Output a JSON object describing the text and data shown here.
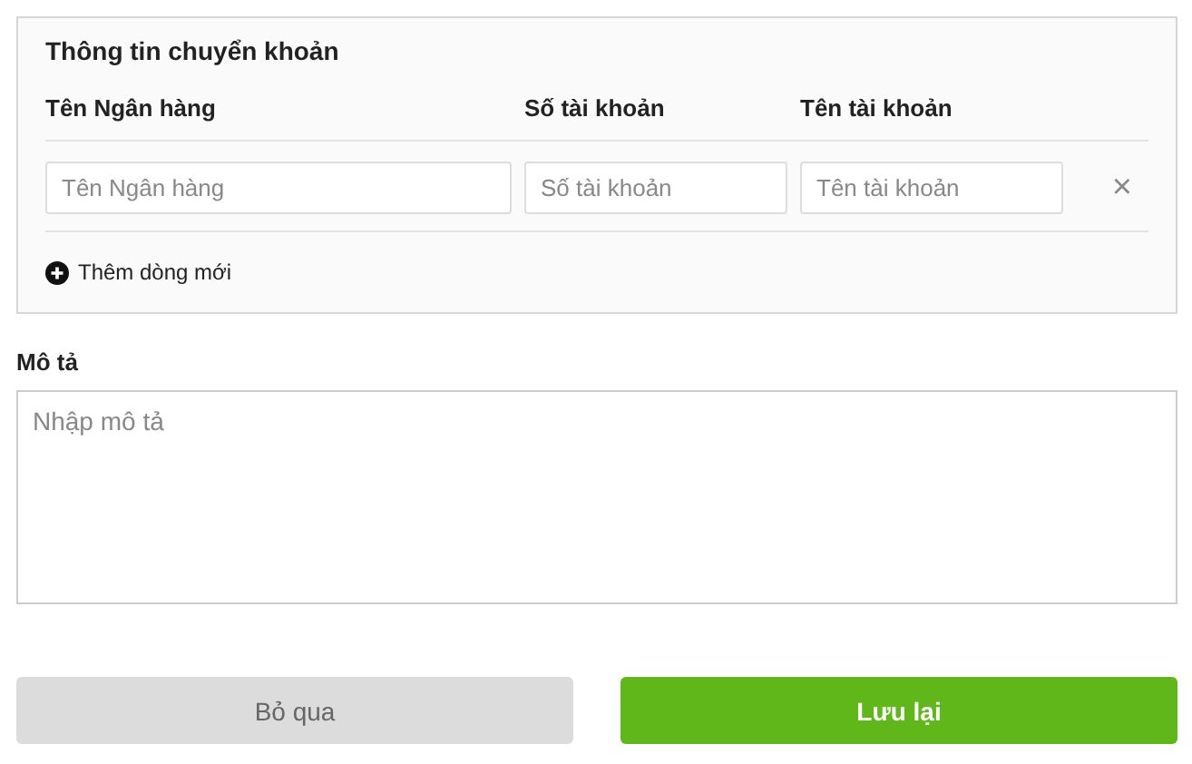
{
  "transfer_info": {
    "title": "Thông tin chuyển khoản",
    "columns": [
      "Tên Ngân hàng",
      "Số tài khoản",
      "Tên tài khoản"
    ],
    "rows": [
      {
        "bank_name": {
          "placeholder": "Tên Ngân hàng"
        },
        "account_number": {
          "placeholder": "Số tài khoản"
        },
        "account_name": {
          "placeholder": "Tên tài khoản"
        },
        "remove": "×"
      }
    ],
    "add_row": "Thêm dòng mới"
  },
  "description": {
    "label": "Mô tả",
    "placeholder": "Nhập mô tả"
  },
  "buttons": [
    {
      "kind": "secondary",
      "label": "Bỏ qua"
    },
    {
      "kind": "primary",
      "label": "Lưu lại"
    }
  ]
}
